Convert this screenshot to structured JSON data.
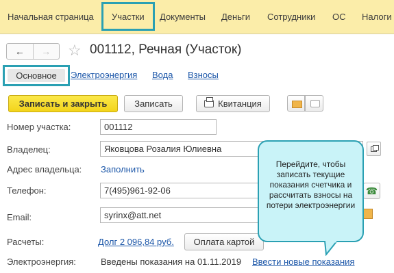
{
  "topnav": {
    "items": [
      "Начальная страница",
      "Участки",
      "Документы",
      "Деньги",
      "Сотрудники",
      "ОС",
      "Налоги"
    ],
    "active": "Участки"
  },
  "window": {
    "title": "001112, Речная (Участок)",
    "back_icon": "arrow-left-icon",
    "forward_icon": "arrow-right-icon",
    "favorite_icon": "star-icon"
  },
  "tabs": {
    "main": "Основное",
    "links": [
      "Электроэнергия",
      "Вода",
      "Взносы"
    ]
  },
  "toolbar": {
    "save_close": "Записать и закрыть",
    "save": "Записать",
    "receipt": "Квитанция",
    "receipt_icon": "printer-icon",
    "mail_icon": "envelope-icon",
    "comment_icon": "speech-bubble-icon"
  },
  "form": {
    "number_label": "Номер участка:",
    "number_value": "001112",
    "owner_label": "Владелец:",
    "owner_value": "Яковцова Розалия Юлиевна",
    "address_label": "Адрес владельца:",
    "address_link": "Заполнить",
    "phone_label": "Телефон:",
    "phone_value": "7(495)961-92-06",
    "email_label": "Email:",
    "email_value": "syrinx@att.net",
    "payments_label": "Расчеты:",
    "debt_link": "Долг 2 096,84 руб.",
    "pay_card": "Оплата картой",
    "electricity_label": "Электроэнергия:",
    "electricity_status": "Введены показания на 01.11.2019",
    "electricity_link": "Ввести новые показания"
  },
  "tooltip": {
    "text": "Перейдите, чтобы записать текущие показания счетчика и рассчитать взносы на потери электроэнергии"
  },
  "colors": {
    "nav_bg": "#fbeda9",
    "highlight": "#2aa0b3",
    "primary_button": "#f5d825",
    "link": "#1b56a8",
    "tooltip_bg": "#c9f3f8"
  }
}
